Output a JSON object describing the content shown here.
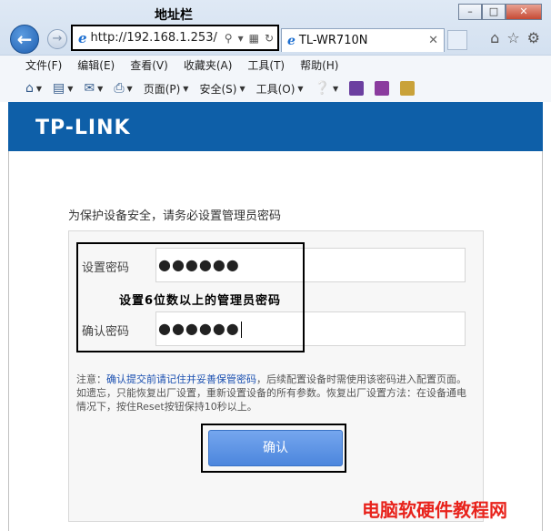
{
  "annotations": {
    "address_bar": "地址栏",
    "password_hint": "设置6位数以上的管理员密码"
  },
  "browser": {
    "url": "http://192.168.1.253/",
    "tab_title": "TL-WR710N",
    "menu": [
      "文件(F)",
      "编辑(E)",
      "查看(V)",
      "收藏夹(A)",
      "工具(T)",
      "帮助(H)"
    ],
    "commands": {
      "page": "页面(P)",
      "safety": "安全(S)",
      "tools": "工具(O)"
    }
  },
  "page": {
    "logo": "TP-LINK",
    "intro": "为保护设备安全，请务必设置管理员密码",
    "set_password_label": "设置密码",
    "set_password_value": "●●●●●●",
    "confirm_password_label": "确认密码",
    "confirm_password_value": "●●●●●●",
    "note_prefix": "注意：",
    "note_highlight": "确认提交前请记住并妥善保管密码",
    "note_body": "，后续配置设备时需使用该密码进入配置页面。如遗忘，只能恢复出厂设置，重新设置设备的所有参数。恢复出厂设置方法：在设备通电情况下，按住Reset按钮保持10秒以上。",
    "confirm_button": "确认"
  },
  "watermark": "电脑软硬件教程网",
  "colors": {
    "brand": "#0e5fa8",
    "button": "#5b93e4",
    "watermark": "#e8231c"
  }
}
